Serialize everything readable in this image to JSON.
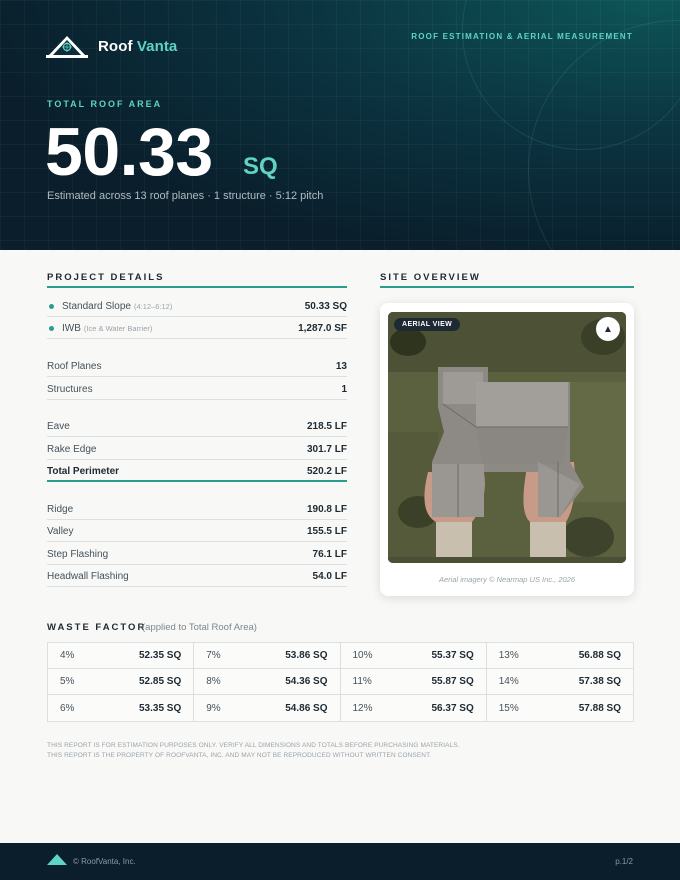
{
  "header": {
    "brand_main": "Roof",
    "brand_accent": "Vanta",
    "tagline": "ROOF ESTIMATION & AERIAL MEASUREMENT",
    "area_label": "TOTAL ROOF AREA",
    "area_value": "50.33",
    "area_unit": "SQ",
    "area_subtitle": "Estimated across 13 roof planes · 1 structure · 5:12 pitch",
    "accent_color": "#5fd3c4"
  },
  "project_details": {
    "title": "PROJECT DETAILS",
    "slope_rows": [
      {
        "label": "Standard Slope",
        "note": "(4:12–6:12)",
        "value": "50.33 SQ"
      },
      {
        "label": "IWB",
        "note": "(Ice & Water Barrier)",
        "value": "1,287.0 SF"
      }
    ],
    "counts": [
      {
        "label": "Roof Planes",
        "value": "13"
      },
      {
        "label": "Structures",
        "value": "1"
      }
    ],
    "perimeter": [
      {
        "label": "Eave",
        "value": "218.5 LF"
      },
      {
        "label": "Rake Edge",
        "value": "301.7 LF"
      },
      {
        "label": "Total Perimeter",
        "value": "520.2 LF"
      }
    ],
    "lines": [
      {
        "label": "Ridge",
        "value": "190.8 LF"
      },
      {
        "label": "Valley",
        "value": "155.5 LF"
      },
      {
        "label": "Step Flashing",
        "value": "76.1 LF"
      },
      {
        "label": "Headwall Flashing",
        "value": "54.0 LF"
      }
    ]
  },
  "site_overview": {
    "title": "SITE OVERVIEW",
    "badge": "AERIAL VIEW",
    "compass": "▲",
    "credit": "Aerial imagery © Nearmap US Inc., 2026"
  },
  "waste_factor": {
    "title": "WASTE FACTOR",
    "note": "(applied to Total Roof Area)",
    "cells": [
      {
        "pct": "4%",
        "sq": "52.35 SQ"
      },
      {
        "pct": "7%",
        "sq": "53.86 SQ"
      },
      {
        "pct": "10%",
        "sq": "55.37 SQ"
      },
      {
        "pct": "13%",
        "sq": "56.88 SQ"
      },
      {
        "pct": "5%",
        "sq": "52.85 SQ"
      },
      {
        "pct": "8%",
        "sq": "54.36 SQ"
      },
      {
        "pct": "11%",
        "sq": "55.87 SQ"
      },
      {
        "pct": "14%",
        "sq": "57.38 SQ"
      },
      {
        "pct": "6%",
        "sq": "53.35 SQ"
      },
      {
        "pct": "9%",
        "sq": "54.86 SQ"
      },
      {
        "pct": "12%",
        "sq": "56.37 SQ"
      },
      {
        "pct": "15%",
        "sq": "57.88 SQ"
      }
    ]
  },
  "disclaimer": {
    "line1": "THIS REPORT IS FOR ESTIMATION PURPOSES ONLY. VERIFY ALL DIMENSIONS AND TOTALS BEFORE PURCHASING MATERIALS.",
    "line2": "THIS REPORT IS THE PROPERTY OF ROOFVANTA, INC. AND MAY NOT BE REPRODUCED WITHOUT WRITTEN CONSENT."
  },
  "footer": {
    "copyright": "© RoofVanta, Inc.",
    "page": "p.1/2"
  }
}
